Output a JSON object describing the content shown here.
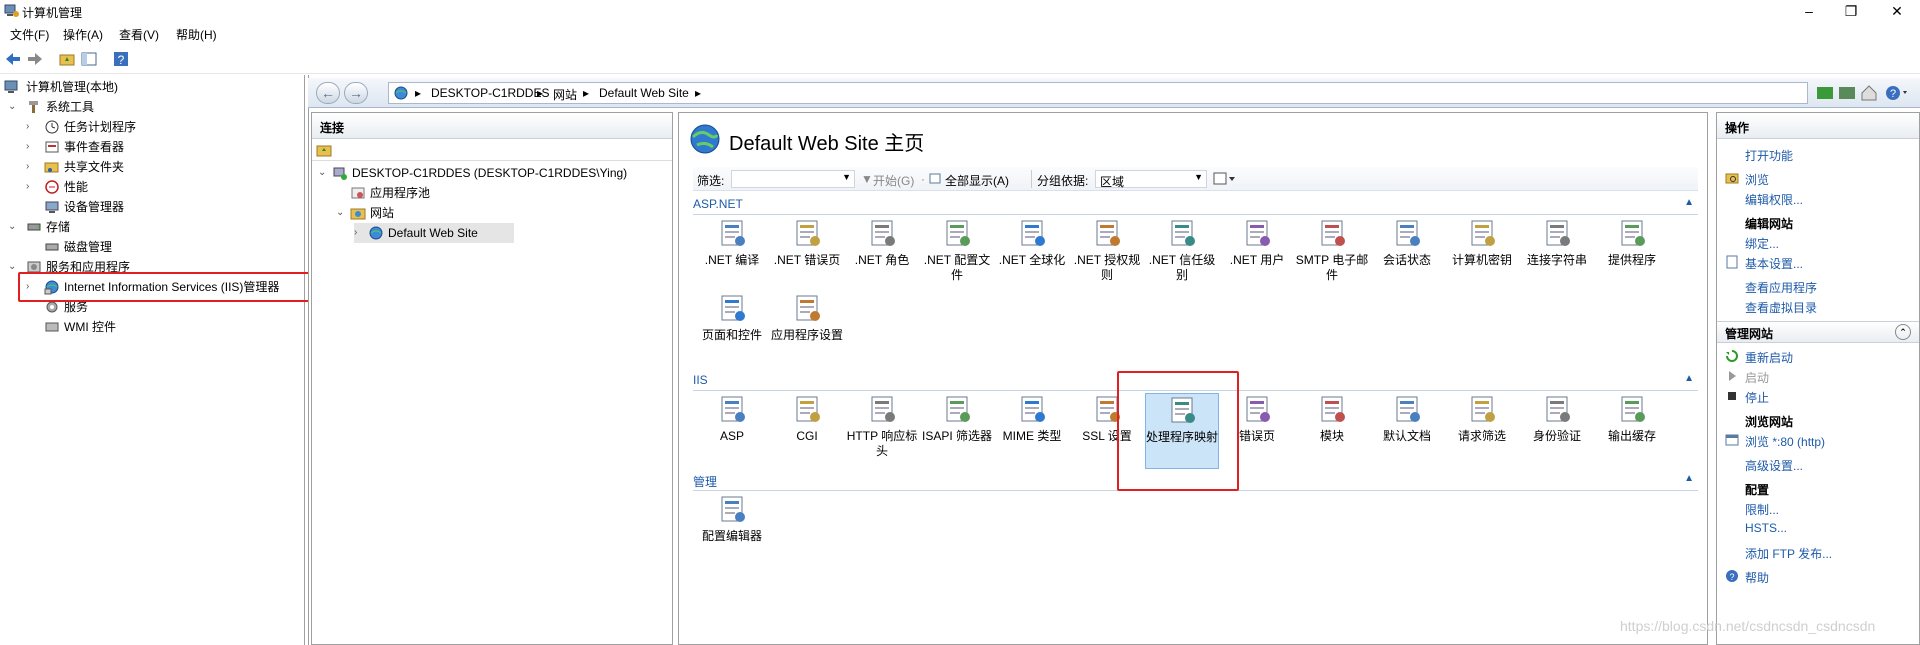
{
  "window": {
    "title": "计算机管理",
    "minimize": "–",
    "maximize": "❐",
    "close": "✕"
  },
  "menu": [
    "文件(F)",
    "操作(A)",
    "查看(V)",
    "帮助(H)"
  ],
  "tree": {
    "root": "计算机管理(本地)",
    "system_tools": "系统工具",
    "task_scheduler": "任务计划程序",
    "event_viewer": "事件查看器",
    "shared_folders": "共享文件夹",
    "performance": "性能",
    "device_manager": "设备管理器",
    "storage": "存储",
    "disk_management": "磁盘管理",
    "services_apps": "服务和应用程序",
    "iis_manager": "Internet Information Services (IIS)管理器",
    "services": "服务",
    "wmi": "WMI 控件"
  },
  "address": [
    "DESKTOP-C1RDDES",
    "网站",
    "Default Web Site"
  ],
  "connections": {
    "header": "连接",
    "server": "DESKTOP-C1RDDES (DESKTOP-C1RDDES\\Ying)",
    "app_pools": "应用程序池",
    "sites": "网站",
    "default_site": "Default Web Site"
  },
  "center": {
    "title": "Default Web Site 主页",
    "filter_label": "筛选:",
    "start_label": "开始(G)",
    "showall_label": "全部显示(A)",
    "groupby_label": "分组依据:",
    "groupby_value": "区域",
    "sections": {
      "aspnet": "ASP.NET",
      "iis": "IIS",
      "mgmt": "管理"
    },
    "aspnet_features": [
      ".NET 编译",
      ".NET 错误页",
      ".NET 角色",
      ".NET 配置文件",
      ".NET 全球化",
      ".NET 授权规则",
      ".NET 信任级别",
      ".NET 用户",
      "SMTP 电子邮件",
      "会话状态",
      "计算机密钥",
      "连接字符串",
      "提供程序",
      "页面和控件",
      "应用程序设置"
    ],
    "iis_features": [
      "ASP",
      "CGI",
      "HTTP 响应标头",
      "ISAPI 筛选器",
      "MIME 类型",
      "SSL 设置",
      "处理程序映射",
      "错误页",
      "模块",
      "默认文档",
      "请求筛选",
      "身份验证",
      "输出缓存"
    ],
    "mgmt_features": [
      "配置编辑器"
    ]
  },
  "actions": {
    "header": "操作",
    "open_feature": "打开功能",
    "explore": "浏览",
    "edit_permissions": "编辑权限...",
    "edit_site": "编辑网站",
    "bindings": "绑定...",
    "basic_settings": "基本设置...",
    "view_apps": "查看应用程序",
    "view_vdirs": "查看虚拟目录",
    "manage_site": "管理网站",
    "restart": "重新启动",
    "start": "启动",
    "stop": "停止",
    "browse_site": "浏览网站",
    "browse_80": "浏览 *:80 (http)",
    "advanced": "高级设置...",
    "config": "配置",
    "limits": "限制...",
    "hsts": "HSTS...",
    "add_ftp": "添加 FTP 发布...",
    "help": "帮助"
  },
  "watermark": "https://blog.csdn.net/csdncsdn_csdncsdn"
}
